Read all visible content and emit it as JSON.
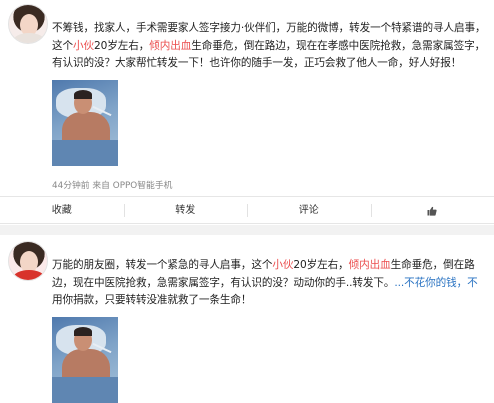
{
  "post1": {
    "lines": [
      [
        {
          "t": "不筹钱，找家人，手术需要家人签字接力·伙伴们，万能的微博，转发一个特紧谱的寻人启事，"
        }
      ],
      [
        {
          "t": "这个"
        },
        {
          "t": "小伙",
          "c": "red"
        },
        {
          "t": "20岁左右，"
        },
        {
          "t": "倾内出血",
          "c": "red"
        },
        {
          "t": "生命垂危，倒在路边，现在在孝感中医院抢救，急需家属签字，"
        }
      ],
      [
        {
          "t": "有认识的没？大家帮忙转发一下！也许你的随手一发，正巧会救了他人一命，好人好报！"
        }
      ]
    ],
    "meta": "44分钟前 来自 OPPO智能手机",
    "actions": [
      "收藏",
      "转发",
      "评论"
    ],
    "like_icon": "thumbs-up-icon"
  },
  "post2": {
    "lines": [
      [
        {
          "t": "万能的朋友圈，转发一个紧急的寻人启事，这个"
        },
        {
          "t": "小伙",
          "c": "red"
        },
        {
          "t": "20岁左右，"
        },
        {
          "t": "倾内出血",
          "c": "red"
        },
        {
          "t": "生命垂危，倒在路"
        }
      ],
      [
        {
          "t": "边，现在中医院抢救，急需家属签字，有认识的没？动动你的手..转发下。"
        },
        {
          "t": "...不花你的钱，不",
          "c": "blue"
        }
      ],
      [
        {
          "t": "用你捐款，只要转转没准就救了一条生命！"
        }
      ]
    ]
  }
}
